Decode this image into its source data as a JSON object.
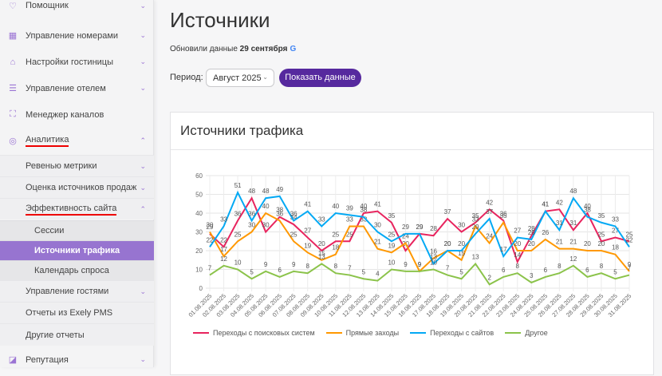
{
  "sidebar": {
    "items": [
      {
        "label": "Помощник",
        "icon": "heart-icon"
      },
      {
        "label": "Управление номерами",
        "icon": "calendar-icon"
      },
      {
        "label": "Настройки гостиницы",
        "icon": "home-icon"
      },
      {
        "label": "Управление отелем",
        "icon": "notes-icon"
      },
      {
        "label": "Менеджер каналов",
        "icon": "hierarchy-icon"
      },
      {
        "label": "Аналитика",
        "icon": "target-icon"
      },
      {
        "label": "Ревенью метрики"
      },
      {
        "label": "Оценка источников продаж"
      },
      {
        "label": "Эффективность сайта"
      },
      {
        "label": "Сессии"
      },
      {
        "label": "Источники трафика"
      },
      {
        "label": "Календарь спроса"
      },
      {
        "label": "Управление гостями"
      },
      {
        "label": "Отчеты из Exely PMS"
      },
      {
        "label": "Другие отчеты"
      },
      {
        "label": "Репутация",
        "icon": "chat-icon"
      }
    ]
  },
  "header": {
    "title": "Источники",
    "updated_prefix": "Обновили данные",
    "updated_date": "29 сентября",
    "period_label": "Период:",
    "period_value": "Август 2025",
    "show_button": "Показать данные"
  },
  "colors": {
    "search": "#e8245e",
    "direct": "#ff9800",
    "sites": "#03a9f4",
    "other": "#8bc34a",
    "accent": "#56299e",
    "active": "#9774d0"
  },
  "chart_data": {
    "type": "line",
    "title": "Источники трафика",
    "ylim": [
      0,
      60
    ],
    "yticks": [
      "0",
      "10",
      "20",
      "30",
      "40",
      "50",
      "60"
    ],
    "grid": true,
    "legend": "bottom-left",
    "x": [
      "01.08.2025",
      "02.08.2025",
      "03.08.2025",
      "04.08.2025",
      "05.08.2025",
      "06.08.2025",
      "07.08.2025",
      "08.08.2025",
      "09.08.2025",
      "10.08.2025",
      "11.08.2025",
      "12.08.2025",
      "13.08.2025",
      "14.08.2025",
      "15.08.2025",
      "16.08.2025",
      "17.08.2025",
      "18.08.2025",
      "19.08.2025",
      "20.08.2025",
      "21.08.2025",
      "22.08.2025",
      "23.08.2025",
      "24.08.2025",
      "25.08.2025",
      "26.08.2025",
      "27.08.2025",
      "28.08.2025",
      "29.08.2025",
      "30.08.2025",
      "31.08.2025"
    ],
    "series": [
      {
        "name": "Переходы с поисковых систем",
        "color": "#e8245e",
        "values": [
          29,
          22,
          36,
          48,
          30,
          38,
          34,
          27,
          20,
          25,
          25,
          40,
          41,
          35,
          20,
          29,
          28,
          37,
          30,
          35,
          42,
          36,
          14,
          28,
          41,
          42,
          31,
          40,
          25,
          27,
          25
        ]
      },
      {
        "name": "Прямые заходы",
        "color": "#ff9800",
        "values": [
          30,
          17,
          25,
          30,
          40,
          36,
          25,
          19,
          15,
          18,
          33,
          33,
          21,
          19,
          24,
          9,
          16,
          20,
          15,
          33,
          24,
          35,
          20,
          20,
          26,
          21,
          21,
          20,
          20,
          18,
          9
        ]
      },
      {
        "name": "Переходы с сайтов",
        "color": "#03a9f4",
        "values": [
          22,
          33,
          51,
          36,
          48,
          49,
          36,
          41,
          33,
          40,
          39,
          38,
          30,
          25,
          29,
          29,
          13,
          20,
          20,
          29,
          37,
          17,
          27,
          26,
          41,
          31,
          48,
          38,
          35,
          33,
          22
        ]
      },
      {
        "name": "Другое",
        "color": "#8bc34a",
        "values": [
          7,
          12,
          10,
          5,
          9,
          6,
          9,
          8,
          13,
          8,
          7,
          5,
          4,
          10,
          9,
          9,
          10,
          7,
          5,
          13,
          2,
          6,
          8,
          3,
          6,
          8,
          12,
          6,
          8,
          5,
          7
        ]
      }
    ]
  }
}
